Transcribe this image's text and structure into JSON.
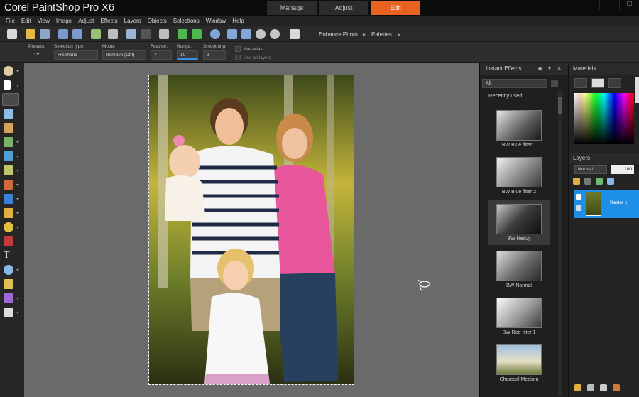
{
  "app": {
    "title": "Corel PaintShop Pro X6",
    "tabs": [
      {
        "label": "Manage",
        "active": false
      },
      {
        "label": "Adjust",
        "active": false
      },
      {
        "label": "Edit",
        "active": true
      }
    ],
    "accent_color": "#e8631f"
  },
  "menu": [
    "File",
    "Edit",
    "View",
    "Image",
    "Adjust",
    "Effects",
    "Layers",
    "Objects",
    "Selections",
    "Window",
    "Help"
  ],
  "toolbar": {
    "enhance_photo_label": "Enhance Photo",
    "palettes_label": "Palettes"
  },
  "options": {
    "presets_label": "Presets:",
    "selection_type_label": "Selection type:",
    "selection_type_value": "Freehand",
    "mode_label": "Mode:",
    "mode_value": "Remove (Ctrl)",
    "feather_label": "Feather:",
    "feather_value": "7",
    "range_label": "Range:",
    "range_value": "10",
    "smoothing_label": "Smoothing:",
    "smoothing_value": "9",
    "antialias_label": "Anti-alias",
    "use_all_layers_label": "Use all layers"
  },
  "instant_effects": {
    "title": "Instant Effects",
    "filter_value": "All",
    "section_label": "Recently used",
    "items": [
      {
        "label": "BW Blue filter 1",
        "selected": false
      },
      {
        "label": "BW Blue filter 2",
        "selected": false
      },
      {
        "label": "BW Heavy",
        "selected": true
      },
      {
        "label": "BW Normal",
        "selected": false
      },
      {
        "label": "BW Red filter 1",
        "selected": false
      },
      {
        "label": "Charcoal Medium",
        "selected": false
      }
    ]
  },
  "materials": {
    "title": "Materials"
  },
  "layers": {
    "title": "Layers",
    "blend_mode": "Normal",
    "opacity": "100",
    "layer_name": "Raster 1",
    "selected_color": "#1e8fe6"
  }
}
